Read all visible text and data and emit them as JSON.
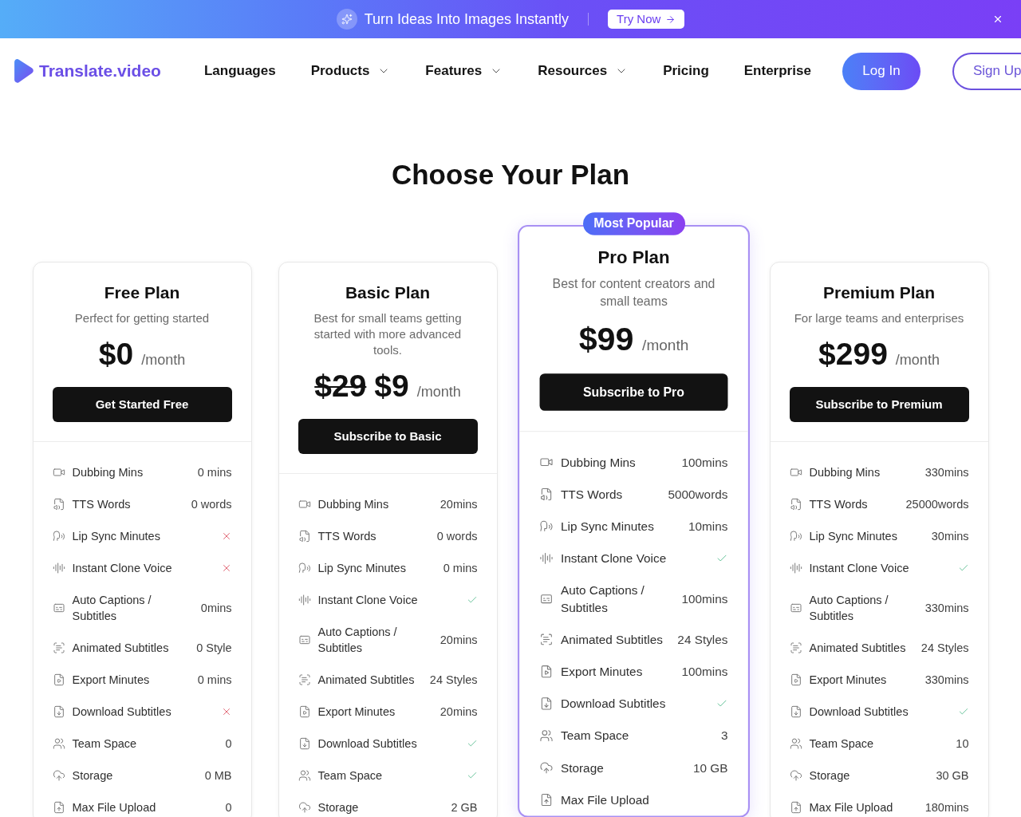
{
  "banner": {
    "text": "Turn Ideas Into Images Instantly",
    "button": "Try Now"
  },
  "nav": {
    "logo": "Translate.video",
    "items": [
      {
        "label": "Languages",
        "has_menu": false
      },
      {
        "label": "Products",
        "has_menu": true
      },
      {
        "label": "Features",
        "has_menu": true
      },
      {
        "label": "Resources",
        "has_menu": true
      },
      {
        "label": "Pricing",
        "has_menu": false
      },
      {
        "label": "Enterprise",
        "has_menu": false
      }
    ],
    "login": "Log In",
    "signup": "Sign Up"
  },
  "title": "Choose Your Plan",
  "plans": [
    {
      "name": "Free Plan",
      "description": "Perfect for getting started",
      "price": "$0",
      "period": "/month",
      "button": "Get Started Free",
      "highlighted": false,
      "features": [
        {
          "label": "Dubbing Mins",
          "kind": "text",
          "value": "0 mins"
        },
        {
          "label": "TTS Words",
          "kind": "text",
          "value": "0 words"
        },
        {
          "label": "Lip Sync Minutes",
          "kind": "mark",
          "included": false
        },
        {
          "label": "Instant Clone Voice",
          "kind": "mark",
          "included": false
        },
        {
          "label": "Auto Captions / Subtitles",
          "kind": "text",
          "value": "0mins"
        },
        {
          "label": "Animated Subtitles",
          "kind": "text",
          "value": "0 Style"
        },
        {
          "label": "Export Minutes",
          "kind": "text",
          "value": "0 mins"
        },
        {
          "label": "Download Subtitles",
          "kind": "mark",
          "included": false
        },
        {
          "label": "Team Space",
          "kind": "text",
          "value": "0"
        },
        {
          "label": "Storage",
          "kind": "text",
          "value": "0 MB"
        },
        {
          "label": "Max File Upload",
          "kind": "text",
          "value": "0"
        }
      ]
    },
    {
      "name": "Basic Plan",
      "description": "Best for small teams getting started with more advanced tools.",
      "original_price": "$29",
      "price": "$9",
      "period": "/month",
      "button": "Subscribe to Basic",
      "highlighted": false,
      "features": [
        {
          "label": "Dubbing Mins",
          "kind": "text",
          "value": "20mins"
        },
        {
          "label": "TTS Words",
          "kind": "text",
          "value": "0 words"
        },
        {
          "label": "Lip Sync Minutes",
          "kind": "text",
          "value": "0 mins"
        },
        {
          "label": "Instant Clone Voice",
          "kind": "mark",
          "included": true
        },
        {
          "label": "Auto Captions / Subtitles",
          "kind": "text",
          "value": "20mins"
        },
        {
          "label": "Animated Subtitles",
          "kind": "text",
          "value": "24 Styles"
        },
        {
          "label": "Export Minutes",
          "kind": "text",
          "value": "20mins"
        },
        {
          "label": "Download Subtitles",
          "kind": "mark",
          "included": true
        },
        {
          "label": "Team Space",
          "kind": "mark",
          "included": true
        },
        {
          "label": "Storage",
          "kind": "text",
          "value": "2 GB"
        }
      ]
    },
    {
      "name": "Pro Plan",
      "badge": "Most Popular",
      "description": "Best for content creators and small teams",
      "price": "$99",
      "period": "/month",
      "button": "Subscribe to Pro",
      "highlighted": true,
      "features": [
        {
          "label": "Dubbing Mins",
          "kind": "text",
          "value": "100mins"
        },
        {
          "label": "TTS Words",
          "kind": "text",
          "value": "5000words"
        },
        {
          "label": "Lip Sync Minutes",
          "kind": "text",
          "value": "10mins"
        },
        {
          "label": "Instant Clone Voice",
          "kind": "mark",
          "included": true
        },
        {
          "label": "Auto Captions / Subtitles",
          "kind": "text",
          "value": "100mins"
        },
        {
          "label": "Animated Subtitles",
          "kind": "text",
          "value": "24 Styles"
        },
        {
          "label": "Export Minutes",
          "kind": "text",
          "value": "100mins"
        },
        {
          "label": "Download Subtitles",
          "kind": "mark",
          "included": true
        },
        {
          "label": "Team Space",
          "kind": "text",
          "value": "3"
        },
        {
          "label": "Storage",
          "kind": "text",
          "value": "10 GB"
        },
        {
          "label": "Max File Upload",
          "kind": "text"
        }
      ]
    },
    {
      "name": "Premium Plan",
      "description": "For large teams and enterprises",
      "price": "$299",
      "period": "/month",
      "button": "Subscribe to Premium",
      "highlighted": false,
      "features": [
        {
          "label": "Dubbing Mins",
          "kind": "text",
          "value": "330mins"
        },
        {
          "label": "TTS Words",
          "kind": "text",
          "value": "25000words"
        },
        {
          "label": "Lip Sync Minutes",
          "kind": "text",
          "value": "30mins"
        },
        {
          "label": "Instant Clone Voice",
          "kind": "mark",
          "included": true
        },
        {
          "label": "Auto Captions / Subtitles",
          "kind": "text",
          "value": "330mins"
        },
        {
          "label": "Animated Subtitles",
          "kind": "text",
          "value": "24 Styles"
        },
        {
          "label": "Export Minutes",
          "kind": "text",
          "value": "330mins"
        },
        {
          "label": "Download Subtitles",
          "kind": "mark",
          "included": true
        },
        {
          "label": "Team Space",
          "kind": "text",
          "value": "10"
        },
        {
          "label": "Storage",
          "kind": "text",
          "value": "30 GB"
        },
        {
          "label": "Max File Upload",
          "kind": "text",
          "value": "180mins"
        }
      ]
    }
  ]
}
